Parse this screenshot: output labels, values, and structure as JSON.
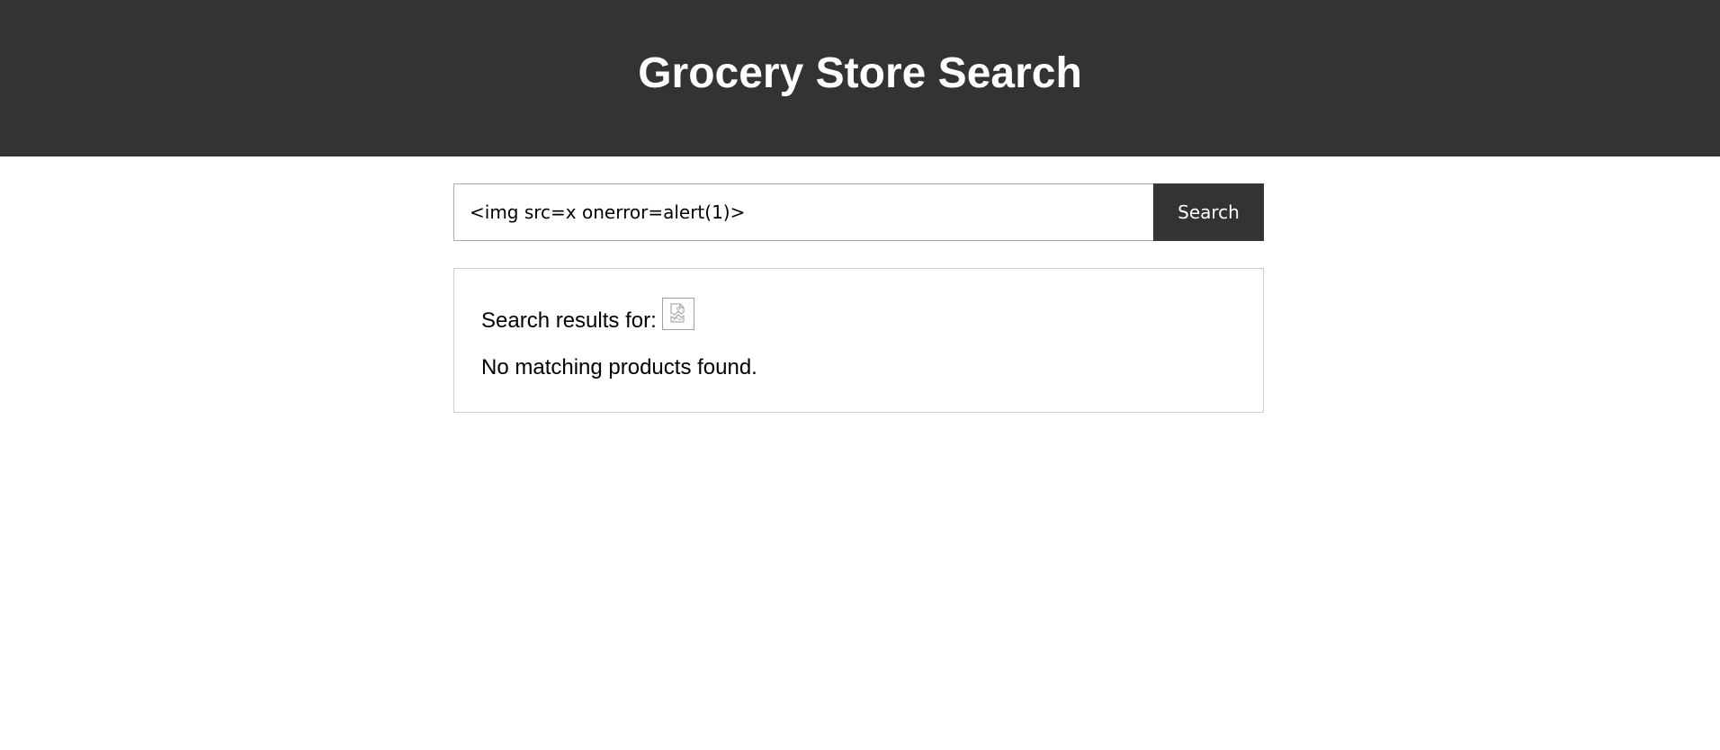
{
  "header": {
    "title": "Grocery Store Search"
  },
  "search": {
    "value": "<img src=x onerror=alert(1)>",
    "button_label": "Search"
  },
  "results": {
    "heading_label": "Search results for:",
    "query_icon": "broken-image-icon",
    "empty_message": "No matching products found."
  },
  "colors": {
    "header_bg": "#333333",
    "button_bg": "#333333",
    "text": "#000000",
    "header_text": "#ffffff"
  }
}
